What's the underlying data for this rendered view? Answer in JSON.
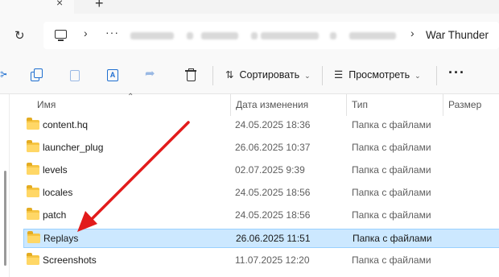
{
  "window": {
    "new_tab_glyph": "+",
    "close_tab_glyph": "×"
  },
  "address": {
    "chevron": "›",
    "overflow": "···",
    "current_folder": "War Thunder"
  },
  "toolbar": {
    "sort_label": "Сортировать",
    "view_label": "Просмотреть",
    "more_label": "···"
  },
  "columns": {
    "name": "Имя",
    "date": "Дата изменения",
    "type": "Тип",
    "size": "Размер"
  },
  "files": [
    {
      "name": "content.hq",
      "date": "24.05.2025 18:36",
      "type": "Папка с файлами"
    },
    {
      "name": "launcher_plug",
      "date": "26.06.2025 10:37",
      "type": "Папка с файлами"
    },
    {
      "name": "levels",
      "date": "02.07.2025 9:39",
      "type": "Папка с файлами"
    },
    {
      "name": "locales",
      "date": "24.05.2025 18:56",
      "type": "Папка с файлами"
    },
    {
      "name": "patch",
      "date": "24.05.2025 18:56",
      "type": "Папка с файлами"
    },
    {
      "name": "Replays",
      "date": "26.06.2025 11:51",
      "type": "Папка с файлами"
    },
    {
      "name": "Screenshots",
      "date": "11.07.2025 12:20",
      "type": "Папка с файлами"
    }
  ],
  "selected_row": "Replays",
  "colors": {
    "selection_bg": "#cce8ff",
    "selection_border": "#99d1ff",
    "annotation_arrow": "#e21b1b",
    "folder": "#ffd766"
  }
}
